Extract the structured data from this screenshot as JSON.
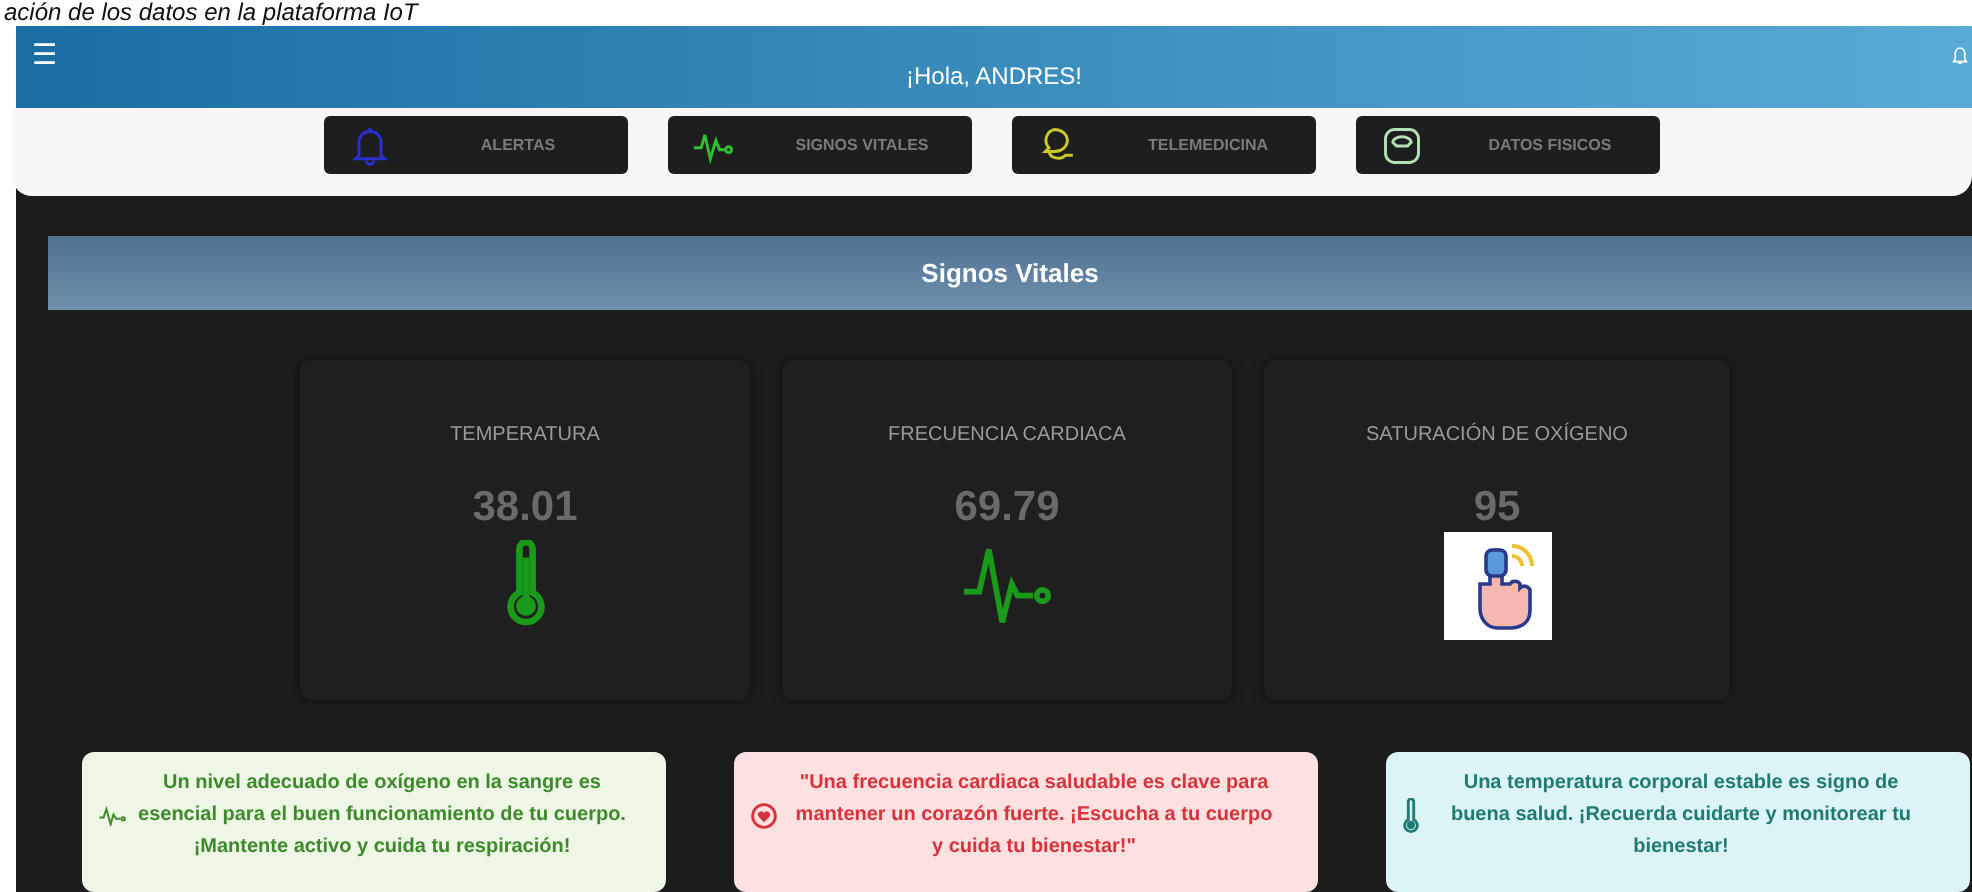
{
  "caption": "ación de los datos en la plataforma IoT",
  "header": {
    "menu": "☰",
    "greeting": "¡Hola, ANDRES!"
  },
  "nav": [
    {
      "label": "ALERTAS",
      "kind": "bell",
      "color": "#2a2fd0"
    },
    {
      "label": "SIGNOS VITALES",
      "kind": "pulse",
      "color": "#2fc02f"
    },
    {
      "label": "TELEMEDICINA",
      "kind": "chat",
      "color": "#c8c82a"
    },
    {
      "label": "DATOS FISICOS",
      "kind": "scale",
      "color": "#b5e0b5"
    }
  ],
  "section_title": "Signos Vitales",
  "vitals": [
    {
      "label": "TEMPERATURA",
      "value": "38.01",
      "kind": "thermometer"
    },
    {
      "label": "FRECUENCIA CARDIACA",
      "value": "69.79",
      "kind": "pulse"
    },
    {
      "label": "SATURACIÓN DE OXÍGENO",
      "value": "95",
      "kind": "oximeter"
    }
  ],
  "tips": [
    {
      "kind": "oxygen",
      "text": "Un nivel adecuado de oxígeno en la sangre es esencial para el buen funcionamiento de tu cuerpo. ¡Mantente activo y cuida tu respiración!"
    },
    {
      "kind": "heart",
      "text": "\"Una frecuencia cardiaca saludable es clave para mantener un corazón fuerte. ¡Escucha a tu cuerpo y cuida tu bienestar!\""
    },
    {
      "kind": "temperature",
      "text": "Una temperatura corporal estable es signo de buena salud. ¡Recuerda cuidarte y monitorear tu bienestar!"
    }
  ]
}
